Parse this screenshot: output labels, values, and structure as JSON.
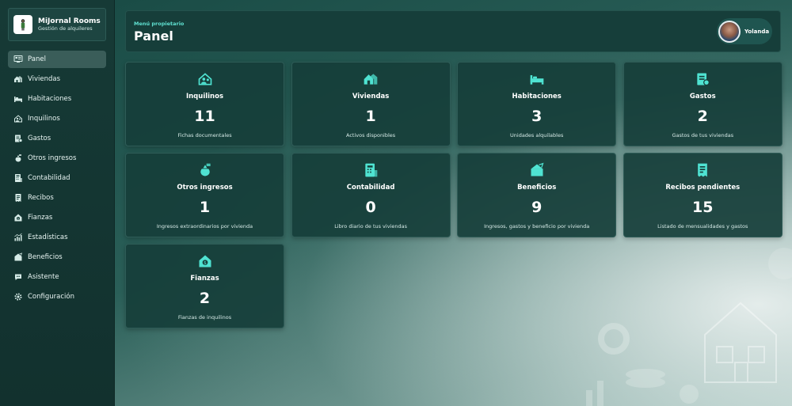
{
  "brand": {
    "name": "MiJornal Rooms",
    "subtitle": "Gestión de alquileres"
  },
  "nav": [
    {
      "label": "Panel",
      "icon": "dashboard-icon",
      "active": true
    },
    {
      "label": "Viviendas",
      "icon": "houses-icon"
    },
    {
      "label": "Habitaciones",
      "icon": "bed-icon"
    },
    {
      "label": "Inquilinos",
      "icon": "tenants-icon"
    },
    {
      "label": "Gastos",
      "icon": "expenses-icon"
    },
    {
      "label": "Otros ingresos",
      "icon": "income-icon"
    },
    {
      "label": "Contabilidad",
      "icon": "accounting-icon"
    },
    {
      "label": "Recibos",
      "icon": "receipts-icon"
    },
    {
      "label": "Fianzas",
      "icon": "deposits-icon"
    },
    {
      "label": "Estadísticas",
      "icon": "stats-icon"
    },
    {
      "label": "Beneficios",
      "icon": "profits-icon"
    },
    {
      "label": "Asistente",
      "icon": "assistant-icon"
    },
    {
      "label": "Configuración",
      "icon": "settings-icon"
    }
  ],
  "header": {
    "kicker": "Menú propietario",
    "title": "Panel"
  },
  "user": {
    "name": "Yolanda"
  },
  "cards": [
    {
      "title": "Inquilinos",
      "value": "11",
      "desc": "Fichas documentales",
      "icon": "tenants-icon"
    },
    {
      "title": "Viviendas",
      "value": "1",
      "desc": "Activos disponibles",
      "icon": "houses-icon"
    },
    {
      "title": "Habitaciones",
      "value": "3",
      "desc": "Unidades alquilables",
      "icon": "bed-icon"
    },
    {
      "title": "Gastos",
      "value": "2",
      "desc": "Gastos de tus viviendas",
      "icon": "expenses-icon"
    },
    {
      "title": "Otros ingresos",
      "value": "1",
      "desc": "Ingresos extraordinarios por vivienda",
      "icon": "income-icon"
    },
    {
      "title": "Contabilidad",
      "value": "0",
      "desc": "Libro diario de tus viviendas",
      "icon": "accounting-icon"
    },
    {
      "title": "Beneficios",
      "value": "9",
      "desc": "Ingresos, gastos y beneficio por vivienda",
      "icon": "profits-icon"
    },
    {
      "title": "Recibos pendientes",
      "value": "15",
      "desc": "Listado de mensualidades y gastos",
      "icon": "receipts-icon"
    },
    {
      "title": "Fianzas",
      "value": "2",
      "desc": "Fianzas de inquilinos",
      "icon": "deposits-icon"
    }
  ],
  "colors": {
    "accent": "#4fe3d2",
    "sidebar": "#163a36",
    "card": "#163e3a"
  }
}
